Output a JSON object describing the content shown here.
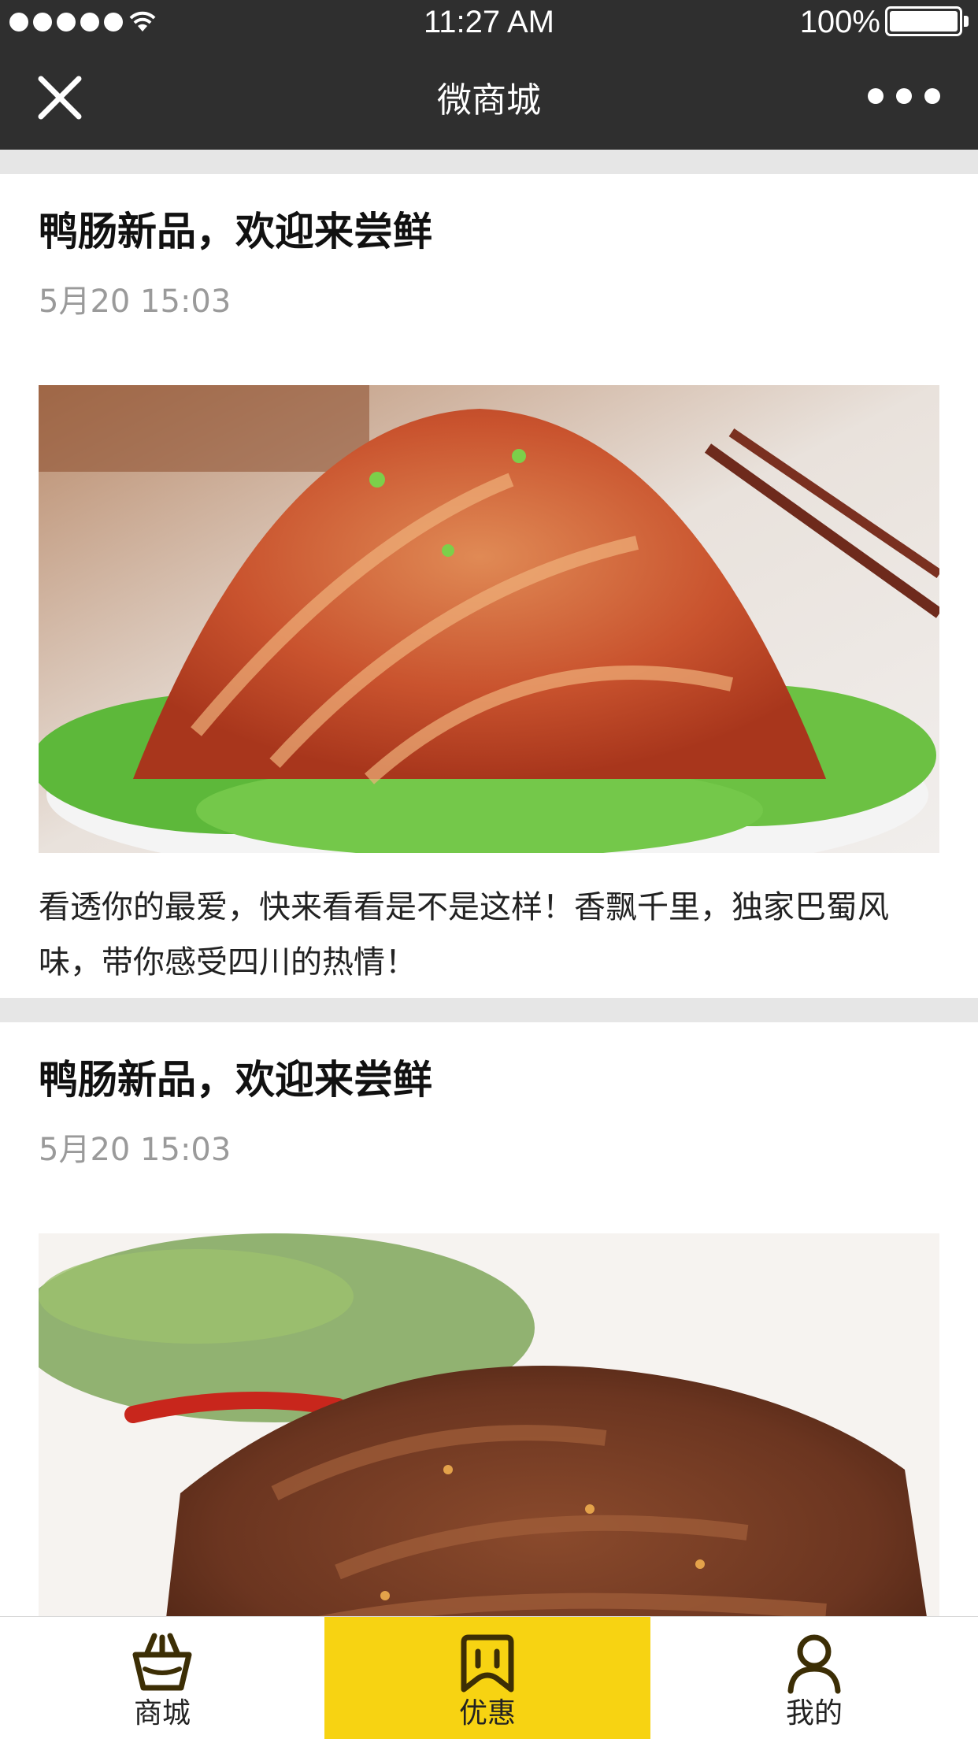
{
  "status_bar": {
    "time": "11:27 AM",
    "battery_percent_label": "100%",
    "signal_bars": 5,
    "battery_level": 1.0
  },
  "nav": {
    "title": "微商城",
    "close_icon": "close-icon",
    "more_icon": "more-dots-icon"
  },
  "posts": [
    {
      "title": "鸭肠新品，欢迎来尝鲜",
      "date": "5月20 15:03",
      "image": "spicy-shredded-dish-photo",
      "description": "看透你的最爱，快来看看是不是这样！香飘千里，独家巴蜀风味，带你感受四川的热情！"
    },
    {
      "title": "鸭肠新品，欢迎来尝鲜",
      "date": "5月20 15:03",
      "image": "braised-meat-dish-photo",
      "description": ""
    }
  ],
  "tabs": [
    {
      "label": "商城",
      "icon": "basket-icon",
      "active": false
    },
    {
      "label": "优惠",
      "icon": "coupon-icon",
      "active": true
    },
    {
      "label": "我的",
      "icon": "user-icon",
      "active": false
    }
  ],
  "colors": {
    "nav_bg": "#2f2f2f",
    "accent": "#f7d312",
    "page_bg": "#e6e6e6",
    "icon_color": "#3c2e05"
  }
}
